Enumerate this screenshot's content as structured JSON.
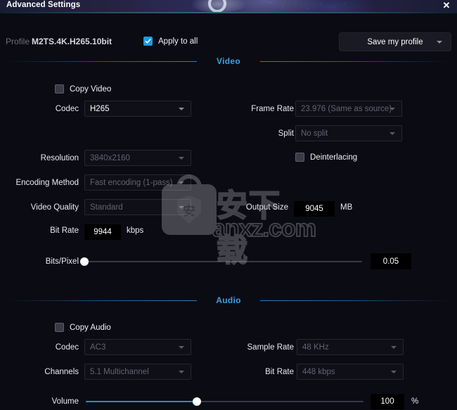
{
  "window": {
    "title": "Advanced Settings",
    "close_icon": "close-icon"
  },
  "profile": {
    "label": "Profile",
    "value": "M2TS.4K.H265.10bit",
    "apply_to_all_label": "Apply to all",
    "apply_to_all_checked": true,
    "save_button_label": "Save my profile"
  },
  "video": {
    "section_title": "Video",
    "copy_video": {
      "label": "Copy Video",
      "checked": false
    },
    "codec": {
      "label": "Codec",
      "value": "H265",
      "disabled": false
    },
    "resolution": {
      "label": "Resolution",
      "value": "3840x2160",
      "disabled": true
    },
    "encoding_method": {
      "label": "Encoding Method",
      "value": "Fast encoding (1-pass)",
      "disabled": true
    },
    "video_quality": {
      "label": "Video Quality",
      "value": "Standard",
      "disabled": true
    },
    "bit_rate": {
      "label": "Bit Rate",
      "value": "9944",
      "unit": "kbps"
    },
    "frame_rate": {
      "label": "Frame Rate",
      "value": "23.976 (Same as source)",
      "disabled": true
    },
    "split": {
      "label": "Split",
      "value": "No split",
      "disabled": true
    },
    "deinterlacing": {
      "label": "Deinterlacing",
      "checked": false
    },
    "output_size": {
      "label": "Output Size",
      "value": "9045",
      "unit": "MB"
    },
    "bits_per_pixel": {
      "label": "Bits/Pixel",
      "value": "0.05",
      "percent": 0
    }
  },
  "audio": {
    "section_title": "Audio",
    "copy_audio": {
      "label": "Copy Audio",
      "checked": false
    },
    "codec": {
      "label": "Codec",
      "value": "AC3",
      "disabled": true
    },
    "channels": {
      "label": "Channels",
      "value": "5.1 Multichannel",
      "disabled": true
    },
    "sample_rate": {
      "label": "Sample Rate",
      "value": "48 KHz",
      "disabled": true
    },
    "bit_rate": {
      "label": "Bit Rate",
      "value": "448 kbps",
      "disabled": true
    },
    "volume": {
      "label": "Volume",
      "value": "100",
      "unit": "%",
      "percent": 40
    }
  },
  "watermark": {
    "cn_text": "安下载",
    "domain_text": "anxz.com",
    "shield_glyph": "安"
  },
  "colors": {
    "accent": "#3ba1e3",
    "checkbox_checked": "#1f9ae0",
    "slider_fill": "#1f8fd6",
    "panel_bg": "#0b0b14",
    "field_bg": "#0f0f18"
  }
}
